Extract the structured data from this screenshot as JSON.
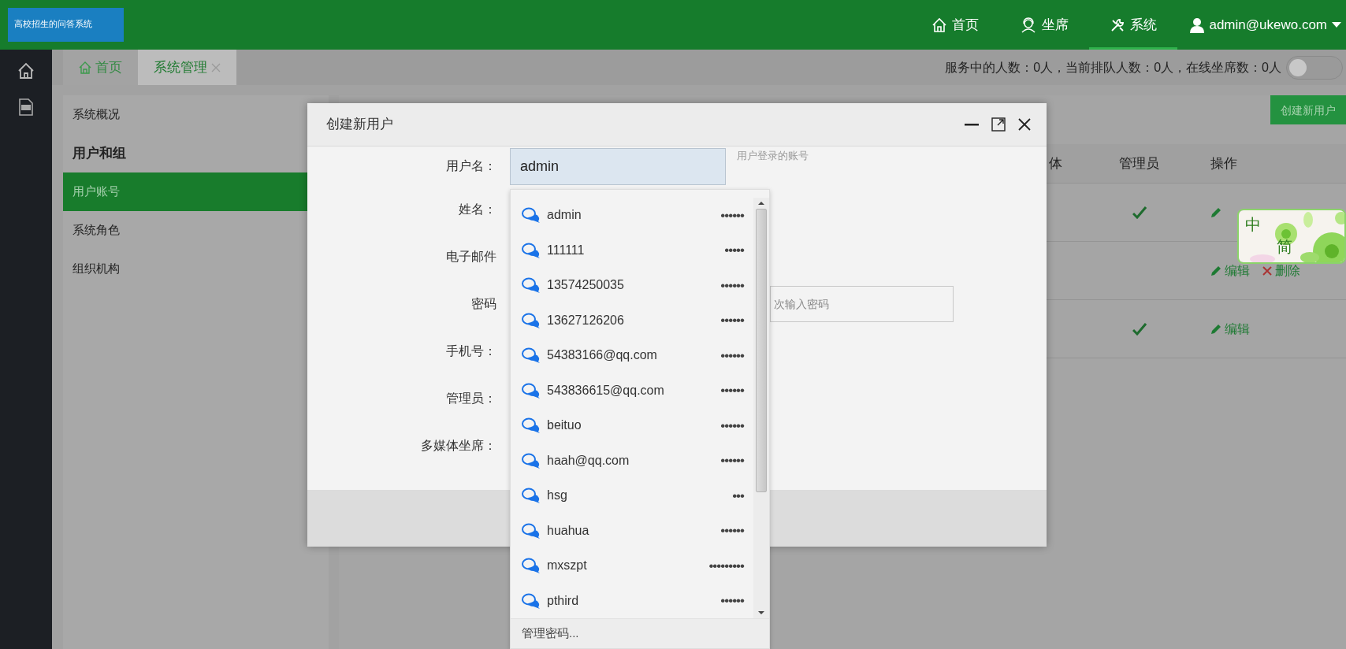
{
  "logo": "高校招生的问答系统",
  "top_nav": [
    {
      "label": "首页",
      "selected": false
    },
    {
      "label": "坐席",
      "selected": false
    },
    {
      "label": "系统",
      "selected": true
    }
  ],
  "user_menu": {
    "label": "admin@ukewo.com"
  },
  "tabs": [
    {
      "label": "首页",
      "selected": false,
      "closable": false
    },
    {
      "label": "系统管理",
      "selected": true,
      "closable": true
    }
  ],
  "status_text": "服务中的人数：0人，当前排队人数：0人，在线坐席数：0人",
  "status_toggle": {
    "on": false
  },
  "sidebar": {
    "items": [
      {
        "label": "系统概况",
        "kind": "item",
        "selected": false
      },
      {
        "label": "用户和组",
        "kind": "heading",
        "selected": false
      },
      {
        "label": "用户账号",
        "kind": "item",
        "selected": true
      },
      {
        "label": "系统角色",
        "kind": "item",
        "selected": false
      },
      {
        "label": "组织机构",
        "kind": "item",
        "selected": false
      }
    ]
  },
  "create_button": "创建新用户",
  "table": {
    "columns": [
      "体",
      "管理员",
      "操作"
    ],
    "rows": [
      {
        "admin": true,
        "actions": [
          {
            "kind": "edit"
          }
        ]
      },
      {
        "admin": false,
        "actions": [
          {
            "kind": "edit",
            "label": "编辑"
          },
          {
            "kind": "delete",
            "label": "删除"
          }
        ]
      },
      {
        "admin": true,
        "actions": [
          {
            "kind": "edit",
            "label": "编辑"
          }
        ]
      }
    ]
  },
  "ime_bar": {
    "mode": "中",
    "charset": "简"
  },
  "dialog": {
    "title": "创建新用户",
    "fields": [
      {
        "label": "用户名：",
        "value": "admin",
        "hint": "用户登录的账号"
      },
      {
        "label": "姓名："
      },
      {
        "label": "电子邮件"
      },
      {
        "label": "密码",
        "side_placeholder": "次输入密码"
      },
      {
        "label": "手机号："
      },
      {
        "label": "管理员："
      },
      {
        "label": "多媒体坐席："
      }
    ]
  },
  "autofill": {
    "items": [
      {
        "login": "admin",
        "password": "••••••"
      },
      {
        "login": "111111",
        "password": "•••••"
      },
      {
        "login": "13574250035",
        "password": "••••••"
      },
      {
        "login": "13627126206",
        "password": "••••••"
      },
      {
        "login": "54383166@qq.com",
        "password": "••••••"
      },
      {
        "login": "543836615@qq.com",
        "password": "••••••"
      },
      {
        "login": "beituo",
        "password": "••••••"
      },
      {
        "login": "haah@qq.com",
        "password": "••••••"
      },
      {
        "login": "hsg",
        "password": "•••"
      },
      {
        "login": "huahua",
        "password": "••••••"
      },
      {
        "login": "mxszpt",
        "password": "•••••••••"
      },
      {
        "login": "pthird",
        "password": "••••••"
      }
    ],
    "footer": "管理密码..."
  }
}
